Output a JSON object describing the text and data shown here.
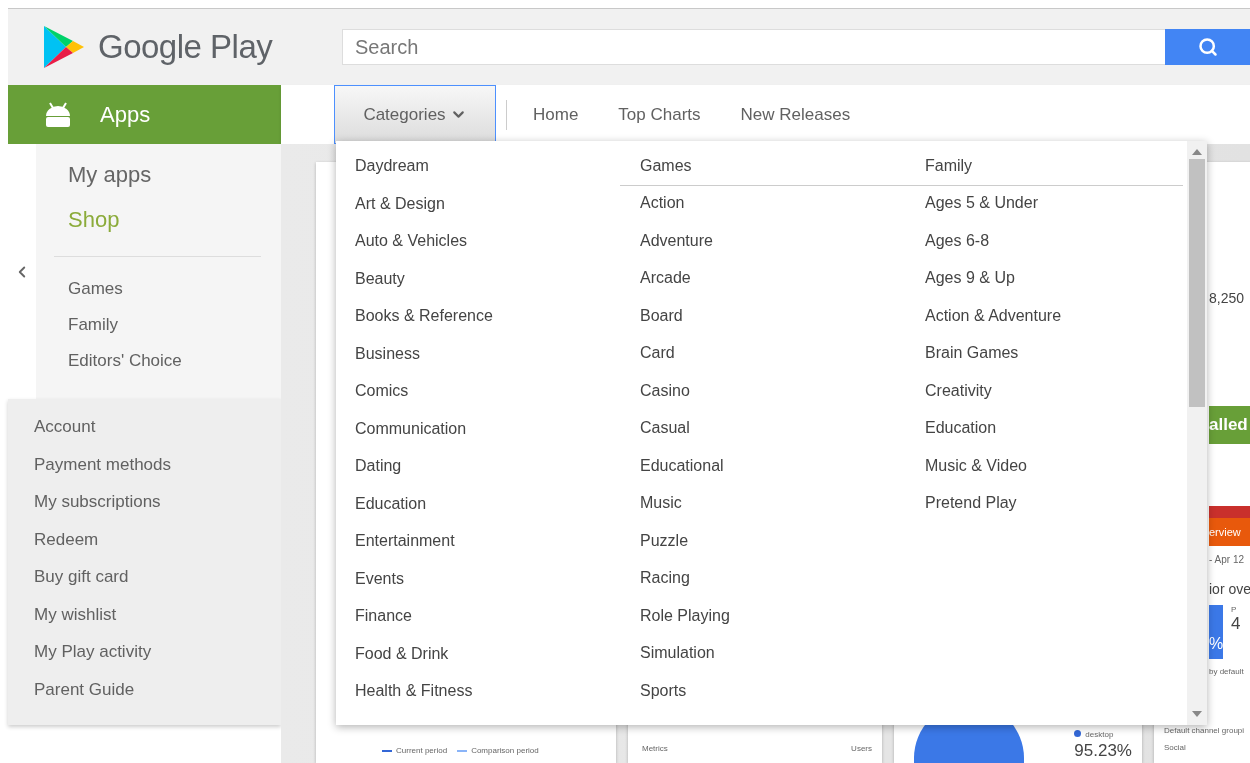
{
  "header": {
    "logo": "Google Play",
    "search": {
      "placeholder": "Search"
    }
  },
  "section": {
    "label": "Apps",
    "selected": true
  },
  "nav": {
    "categories": {
      "label": "Categories",
      "expanded": true
    },
    "links": [
      "Home",
      "Top Charts",
      "New Releases"
    ]
  },
  "sidebar": {
    "items": [
      {
        "label": "My apps",
        "selected": false
      },
      {
        "label": "Shop",
        "selected": true
      }
    ],
    "links": [
      "Games",
      "Family",
      "Editors' Choice"
    ],
    "account": [
      "Account",
      "Payment methods",
      "My subscriptions",
      "Redeem",
      "Buy gift card",
      "My wishlist",
      "My Play activity",
      "Parent Guide"
    ]
  },
  "categories_menu": {
    "columns": [
      {
        "items": [
          "Daydream",
          "Art & Design",
          "Auto & Vehicles",
          "Beauty",
          "Books & Reference",
          "Business",
          "Comics",
          "Communication",
          "Dating",
          "Education",
          "Entertainment",
          "Events",
          "Finance",
          "Food & Drink",
          "Health & Fitness"
        ]
      },
      {
        "heading": "Games",
        "items": [
          "Action",
          "Adventure",
          "Arcade",
          "Board",
          "Card",
          "Casino",
          "Casual",
          "Educational",
          "Music",
          "Puzzle",
          "Racing",
          "Role Playing",
          "Simulation",
          "Sports"
        ]
      },
      {
        "heading": "Family",
        "items": [
          "Ages 5 & Under",
          "Ages 6-8",
          "Ages 9 & Up",
          "Action & Adventure",
          "Brain Games",
          "Creativity",
          "Education",
          "Music & Video",
          "Pretend Play"
        ]
      }
    ]
  },
  "background_dashboard": {
    "card_1": {
      "legend": [
        "Current period",
        "Comparison period"
      ]
    },
    "card_2": {
      "columns": [
        "Metrics",
        "Users"
      ]
    },
    "card_3": {
      "legend": "desktop",
      "value": "95.23%"
    },
    "card_4": {
      "value": "8,250",
      "button": "alled",
      "banner": "erview",
      "date": "- Apr 12",
      "heading": "ior ove",
      "tile_unit": "%",
      "tile_label": "P",
      "tile_value": "4",
      "note": "by default",
      "row_heading": "Default channel groupi",
      "row": "Social"
    }
  }
}
